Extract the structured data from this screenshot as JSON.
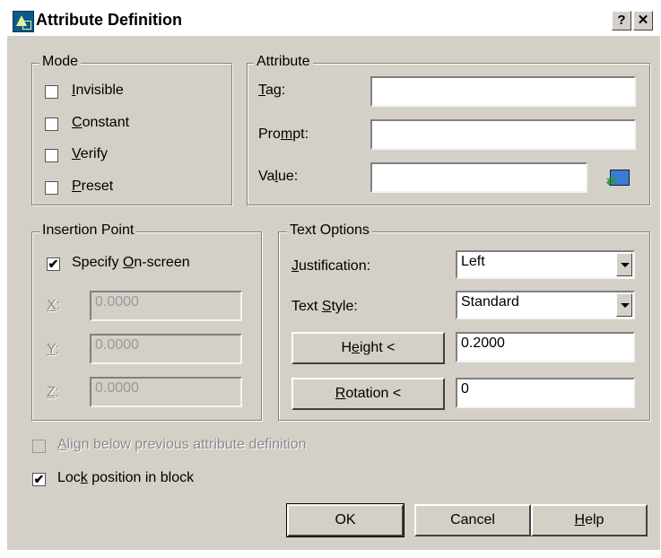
{
  "window": {
    "title": "Attribute Definition",
    "help_glyph": "?",
    "close_glyph": "✕"
  },
  "mode": {
    "legend": "Mode",
    "items": [
      {
        "label": "Invisible",
        "mn": "I",
        "checked": false
      },
      {
        "label": "Constant",
        "mn": "C",
        "checked": false
      },
      {
        "label": "Verify",
        "mn": "V",
        "checked": false
      },
      {
        "label": "Preset",
        "mn": "P",
        "checked": false
      }
    ]
  },
  "attribute": {
    "legend": "Attribute",
    "tag_label": "Tag:",
    "prompt_label": "Prompt:",
    "value_label": "Value:",
    "tag": "",
    "prompt": "",
    "value": ""
  },
  "insertion": {
    "legend": "Insertion Point",
    "specify_label": "Specify On-screen",
    "specify_checked": true,
    "x_label": "X:",
    "y_label": "Y:",
    "z_label": "Z:",
    "x": "0.0000",
    "y": "0.0000",
    "z": "0.0000"
  },
  "text_options": {
    "legend": "Text Options",
    "justification_label": "Justification:",
    "justification": "Left",
    "style_label": "Text Style:",
    "style": "Standard",
    "height_button": "Height <",
    "height": "0.2000",
    "rotation_button": "Rotation <",
    "rotation": "0"
  },
  "align_label": "Align below previous attribute definition",
  "align_checked": false,
  "lock_label": "Lock position in block",
  "lock_checked": true,
  "buttons": {
    "ok": "OK",
    "cancel": "Cancel",
    "help": "Help"
  },
  "icons": {
    "app": "attribute-icon",
    "pick": "value-field-icon"
  },
  "colors": {
    "dialog_bg": "#d4d0c8",
    "text": "#000000",
    "disabled_text": "#8a8a8a"
  }
}
